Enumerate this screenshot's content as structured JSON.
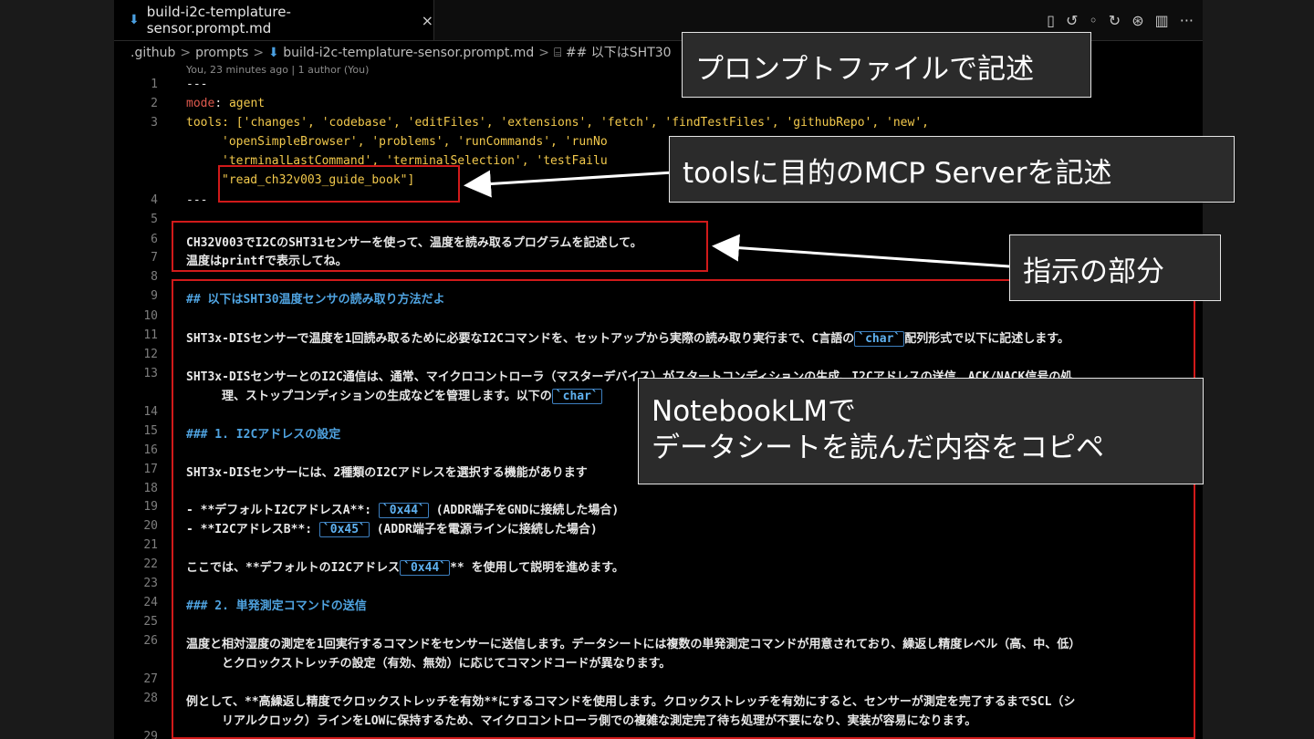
{
  "tab": {
    "icon": "markdown-icon",
    "title": "build-i2c-templature-sensor.prompt.md",
    "close": "×"
  },
  "toolbar": {
    "icons": [
      "open-preview-icon",
      "go-back-icon",
      "timeline-icon",
      "go-forward-icon",
      "copilot-icon",
      "split-editor-icon",
      "more-actions-icon"
    ],
    "glyphs": [
      "▯",
      "↺",
      "◦",
      "↻",
      "⊛",
      "▥",
      "···"
    ]
  },
  "breadcrumb": {
    "items": [
      ".github",
      "prompts",
      "build-i2c-templature-sensor.prompt.md",
      "## 以下はSHT30"
    ],
    "separator": ">",
    "md_icon": "⬇",
    "heading_icon": "⌸"
  },
  "blame": "You, 23 minutes ago | 1 author (You)",
  "lines": [
    {
      "n": "1",
      "text": "---"
    },
    {
      "n": "2",
      "key": "mode",
      "value": "agent"
    },
    {
      "n": "3",
      "text": "tools: ['changes', 'codebase', 'editFiles', 'extensions', 'fetch', 'findTestFiles', 'githubRepo', 'new',"
    },
    {
      "n": "",
      "text": "'openSimpleBrowser', 'problems', 'runCommands', 'runNo"
    },
    {
      "n": "",
      "text": "'terminalLastCommand', 'terminalSelection', 'testFailu"
    },
    {
      "n": "",
      "text": "\"read_ch32v003_guide_book\"]"
    },
    {
      "n": "4",
      "text": "---"
    },
    {
      "n": "5",
      "text": ""
    },
    {
      "n": "6",
      "text": "CH32V003でI2CのSHT31センサーを使って、温度を読み取るプログラムを記述して。"
    },
    {
      "n": "7",
      "text": "温度はprintfで表示してね。"
    },
    {
      "n": "8",
      "text": ""
    },
    {
      "n": "9",
      "text": "## 以下はSHT30温度センサの読み取り方法だよ"
    },
    {
      "n": "10",
      "text": ""
    },
    {
      "n": "11",
      "pre": "SHT3x-DISセンサーで温度を1回読み取るために必要なI2Cコマンドを、セットアップから実際の読み取り実行まで、C言語の",
      "chip": "`char`",
      "post": "配列形式で以下に記述します。"
    },
    {
      "n": "12",
      "text": ""
    },
    {
      "n": "13",
      "text": "SHT3x-DISセンサーとのI2C通信は、通常、マイクロコントローラ（マスターデバイス）がスタートコンディションの生成、I2Cアドレスの送信、ACK/NACK信号の処"
    },
    {
      "n": "",
      "pre": "理、ストップコンディションの生成などを管理します。以下の",
      "chip": "`char`",
      "post": ""
    },
    {
      "n": "14",
      "text": ""
    },
    {
      "n": "15",
      "text": "### 1. I2Cアドレスの設定"
    },
    {
      "n": "16",
      "text": ""
    },
    {
      "n": "17",
      "text": "SHT3x-DISセンサーには、2種類のI2Cアドレスを選択する機能があります"
    },
    {
      "n": "18",
      "text": ""
    },
    {
      "n": "19",
      "pre": "- **デフォルトI2CアドレスA**: ",
      "chip": "`0x44`",
      "post": " (ADDR端子をGNDに接続した場合)"
    },
    {
      "n": "20",
      "pre": "- **I2CアドレスB**: ",
      "chip": "`0x45`",
      "post": " (ADDR端子を電源ラインに接続した場合)"
    },
    {
      "n": "21",
      "text": ""
    },
    {
      "n": "22",
      "pre": "ここでは、**デフォルトのI2Cアドレス",
      "chip": "`0x44`",
      "post": "** を使用して説明を進めます。"
    },
    {
      "n": "23",
      "text": ""
    },
    {
      "n": "24",
      "text": "### 2. 単発測定コマンドの送信"
    },
    {
      "n": "25",
      "text": ""
    },
    {
      "n": "26",
      "text": "温度と相対湿度の測定を1回実行するコマンドをセンサーに送信します。データシートには複数の単発測定コマンドが用意されており、繰返し精度レベル（高、中、低）"
    },
    {
      "n": "",
      "text": "とクロックストレッチの設定（有効、無効）に応じてコマンドコードが異なります。"
    },
    {
      "n": "27",
      "text": ""
    },
    {
      "n": "28",
      "text": "例として、**高繰返し精度でクロックストレッチを有効**にするコマンドを使用します。クロックストレッチを有効にすると、センサーが測定を完了するまでSCL（シ"
    },
    {
      "n": "",
      "text": "リアルクロック）ラインをLOWに保持するため、マイクロコントローラ側での複雑な測定完了待ち処理が不要になり、実装が容易になります。"
    },
    {
      "n": "29",
      "text": ""
    }
  ],
  "callouts": {
    "prompt_file": "プロンプトファイルで記述",
    "tools": "toolsに目的のMCP Serverを記述",
    "instruction": "指示の部分",
    "notebook_line1": "NotebookLMで",
    "notebook_line2": "データシートを読んだ内容をコピペ"
  }
}
